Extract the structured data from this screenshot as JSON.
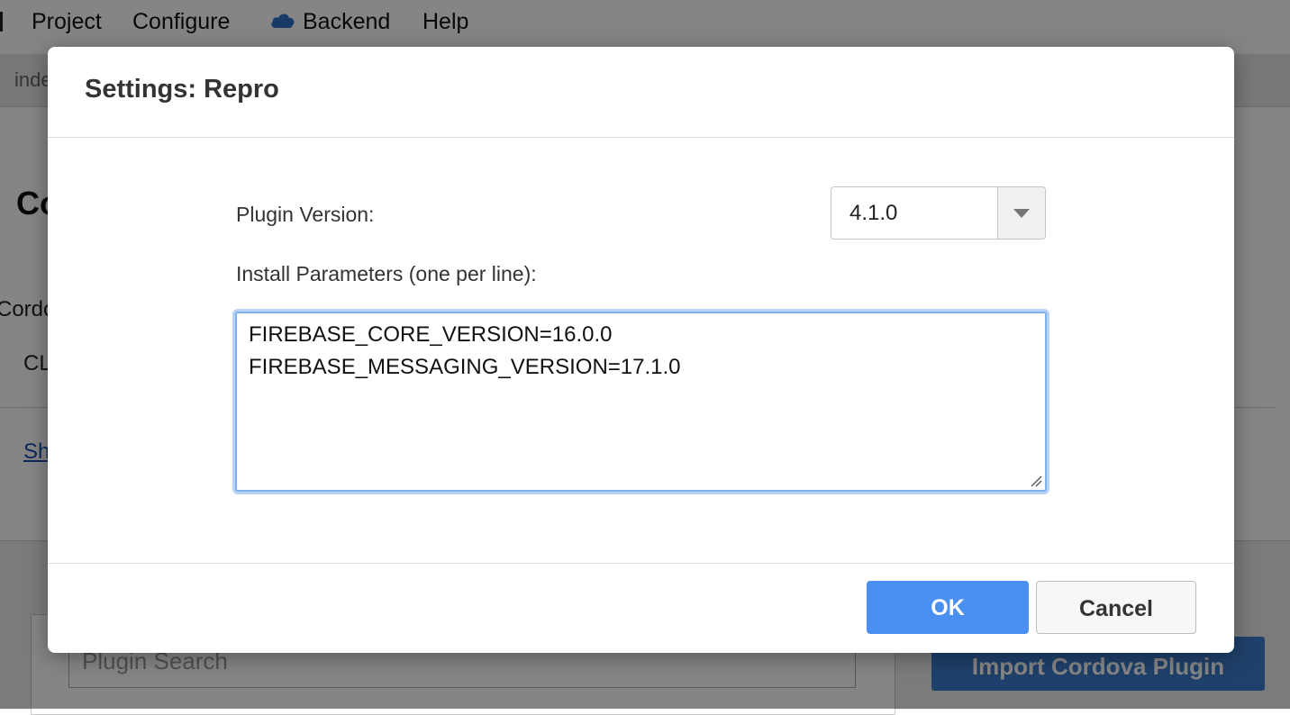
{
  "menubar": {
    "items": [
      "Project",
      "Configure",
      "Backend",
      "Help"
    ]
  },
  "background": {
    "tab_label": "inde",
    "heading_partial": "Co",
    "cordova_partial": "Cordo",
    "cli_partial": "CL",
    "link_partial": "Sh",
    "search_placeholder": "Plugin Search",
    "import_button": "Import Cordova Plugin"
  },
  "dialog": {
    "title": "Settings: Repro",
    "plugin_version_label": "Plugin Version:",
    "plugin_version_value": "4.1.0",
    "install_params_label": "Install Parameters (one per line):",
    "install_params_lines": [
      "FIREBASE_CORE_VERSION=16.0.0",
      "FIREBASE_MESSAGING_VERSION=17.1.0"
    ],
    "ok_label": "OK",
    "cancel_label": "Cancel"
  },
  "colors": {
    "primary_button": "#4a90f0",
    "focus_ring": "#7fb2ee",
    "overlay": "rgba(0,0,0,0.48)"
  },
  "icons": {
    "backend": "cloud-icon",
    "select": "chevron-down-icon",
    "textarea_resize": "resize-grip-icon"
  }
}
